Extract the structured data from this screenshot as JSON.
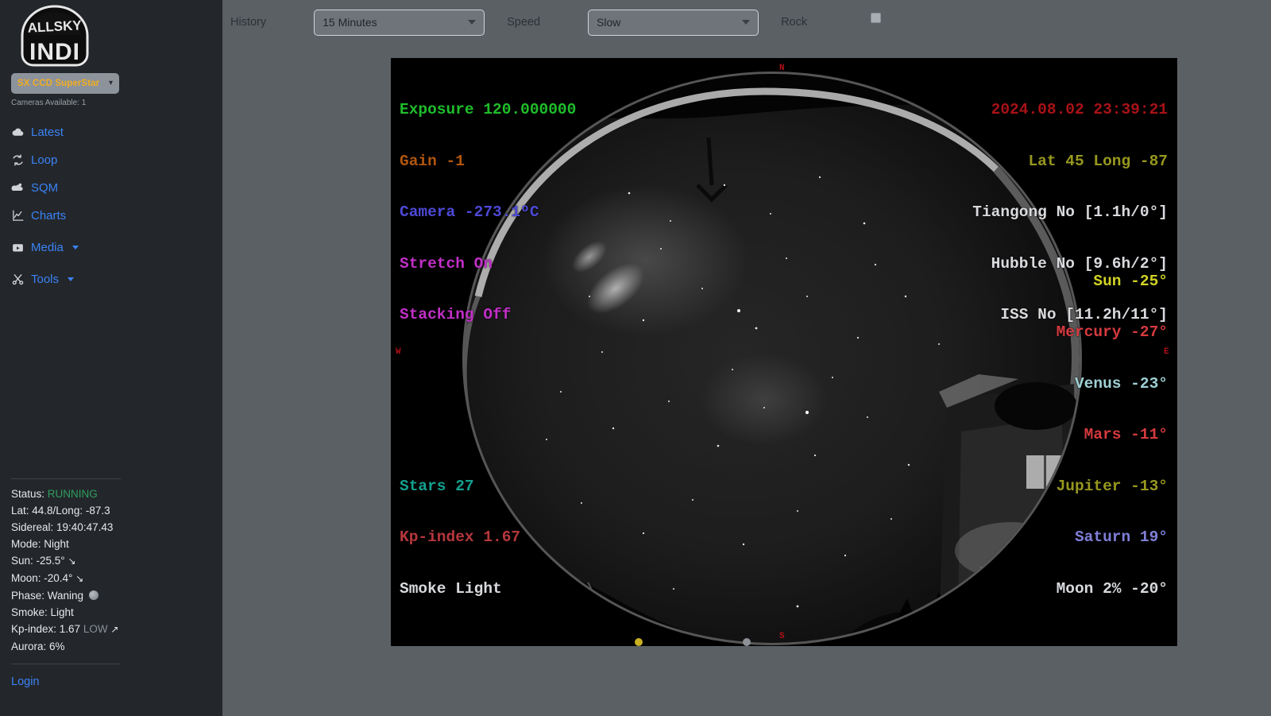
{
  "brand": {
    "line1": "ALLSKY",
    "line2": "INDI"
  },
  "camera_select": {
    "label": "SX CCD SuperStar",
    "icon": "chevron-down-icon"
  },
  "cameras_available": "Cameras Available: 1",
  "sidebar": {
    "items": [
      {
        "label": "Latest",
        "icon": "cloud-icon"
      },
      {
        "label": "Loop",
        "icon": "loop-icon"
      },
      {
        "label": "SQM",
        "icon": "sqm-icon"
      },
      {
        "label": "Charts",
        "icon": "chart-icon"
      },
      {
        "label": "Media",
        "icon": "video-icon",
        "caret": true
      },
      {
        "label": "Tools",
        "icon": "scissors-icon",
        "caret": true
      }
    ],
    "status": {
      "status_label": "Status:",
      "status_value": "RUNNING",
      "latlong": "Lat: 44.8/Long: -87.3",
      "sidereal": "Sidereal: 19:40:47.43",
      "mode": "Mode: Night",
      "sun": "Sun: -25.5°",
      "moon": "Moon: -20.4°",
      "phase": "Phase: Waning",
      "smoke": "Smoke: Light",
      "kp_label": "Kp-index: 1.67",
      "kp_level": "LOW",
      "aurora": "Aurora: 6%"
    },
    "login": "Login"
  },
  "toolbar": {
    "history_label": "History",
    "history_value": "15 Minutes",
    "speed_label": "Speed",
    "speed_value": "Slow",
    "rock_label": "Rock",
    "rock_checked": false
  },
  "overlay": {
    "top_left": {
      "exposure": "Exposure 120.000000",
      "gain": "Gain -1",
      "camera": "Camera -273.1ºC",
      "stretch": "Stretch On",
      "stacking": "Stacking Off"
    },
    "top_right": {
      "timestamp": "2024.08.02 23:39:21",
      "location": "Lat 45 Long -87",
      "tiangong": "Tiangong No [1.1h/0°]",
      "hubble": "Hubble No [9.6h/2°]",
      "iss": "ISS No [11.2h/11°]"
    },
    "bottom_left": {
      "stars": "Stars 27",
      "kp": "Kp-index 1.67",
      "smoke": "Smoke Light"
    },
    "bottom_right": {
      "sun": "Sun -25°",
      "mercury": "Mercury -27°",
      "venus": "Venus -23°",
      "mars": "Mars -11°",
      "jupiter": "Jupiter -13°",
      "saturn": "Saturn 19°",
      "moon": "Moon 2% -20°"
    },
    "cardinals": {
      "n": "N",
      "s": "S",
      "e": "E",
      "w": "W"
    }
  },
  "colors": {
    "accent_link": "#3b82f6",
    "camera_label": "#f0ad22",
    "status_running": "#2f9e5e",
    "sidebar_bg": "#23272b",
    "main_bg": "#5b6065"
  }
}
